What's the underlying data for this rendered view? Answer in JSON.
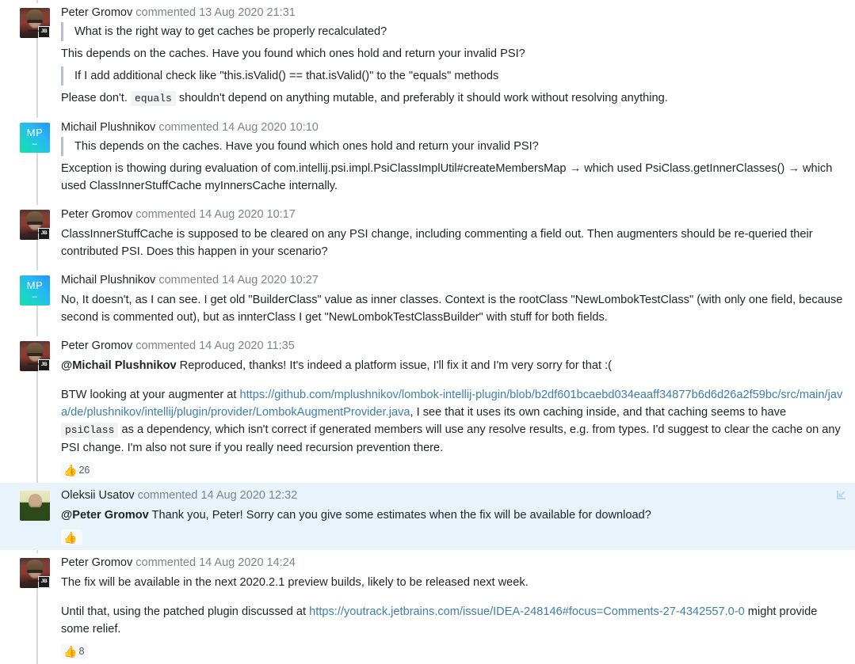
{
  "thread": {
    "comments": [
      {
        "id": "c1",
        "author": "Peter Gromov",
        "verb": "commented",
        "timestamp": "13 Aug 2020 21:31",
        "avatar_type": "photo-peter",
        "avatar_badge": "JB",
        "highlighted": false,
        "blocks": [
          {
            "type": "quote",
            "text": "What is the right way to get caches be properly recalculated?"
          },
          {
            "type": "p",
            "text": "This depends on the caches. Have you found which ones hold and return your invalid PSI?"
          },
          {
            "type": "quote",
            "text": "If I add additional check like \"this.isValid() == that.isValid()\" to the \"equals\" methods"
          },
          {
            "type": "p-rich",
            "parts": [
              {
                "t": "text",
                "v": "Please don't. "
              },
              {
                "t": "code",
                "v": "equals"
              },
              {
                "t": "text",
                "v": " shouldn't depend on anything mutable, and preferably it should work without resolving anything."
              }
            ]
          }
        ],
        "reactions": []
      },
      {
        "id": "c2",
        "author": "Michail Plushnikov",
        "verb": "commented",
        "timestamp": "14 Aug 2020 10:10",
        "avatar_type": "initials",
        "avatar_initials": "MP",
        "avatar_initials_second": "–",
        "highlighted": false,
        "blocks": [
          {
            "type": "quote",
            "text": "This depends on the caches. Have you found which ones hold and return your invalid PSI?"
          },
          {
            "type": "p",
            "text": "Exception is thowing during evaluation of com.intellij.psi.impl.PsiClassImplUtil#createMembersMap → which used PsiClass.getInnerClasses() → which used ClassInnerStuffCache myInnersCache internally."
          }
        ],
        "reactions": []
      },
      {
        "id": "c3",
        "author": "Peter Gromov",
        "verb": "commented",
        "timestamp": "14 Aug 2020 10:17",
        "avatar_type": "photo-peter",
        "avatar_badge": "JB",
        "highlighted": false,
        "blocks": [
          {
            "type": "p",
            "text": "ClassInnerStuffCache is supposed to be cleared on any PSI change, including commenting a field out. Then augmenters should be re-queried their contributed PSI. Does this happen in your scenario?"
          }
        ],
        "reactions": []
      },
      {
        "id": "c4",
        "author": "Michail Plushnikov",
        "verb": "commented",
        "timestamp": "14 Aug 2020 10:27",
        "avatar_type": "initials",
        "avatar_initials": "MP",
        "avatar_initials_second": "–",
        "highlighted": false,
        "blocks": [
          {
            "type": "p",
            "text": "No, It doesn't, as I can see. I get old \"BuilderClass\" value as inner classes. Context is the rootClass \"NewLombokTestClass\" (with only one field, because second is commented out), but as innterClass I get \"NewLombokTestClassBuilder\" with stuff for both fields."
          }
        ],
        "reactions": []
      },
      {
        "id": "c5",
        "author": "Peter Gromov",
        "verb": "commented",
        "timestamp": "14 Aug 2020 11:35",
        "avatar_type": "photo-peter",
        "avatar_badge": "JB",
        "highlighted": false,
        "blocks": [
          {
            "type": "p-rich",
            "parts": [
              {
                "t": "mention",
                "v": "@Michail Plushnikov"
              },
              {
                "t": "text",
                "v": " Reproduced, thanks! It's indeed a platform issue, I'll fix it and I'm very sorry for that :("
              }
            ]
          },
          {
            "type": "p-rich-spaced",
            "parts": [
              {
                "t": "text",
                "v": "BTW looking at your augmenter at "
              },
              {
                "t": "link",
                "v": "https://github.com/mplushnikov/lombok-intellij-plugin/blob/b2df601bcaebd034eaaff34877b6d6d26a2f59bc/src/main/java/de/plushnikov/intellij/plugin/provider/LombokAugmentProvider.java"
              },
              {
                "t": "text",
                "v": ", I see that it uses its own caching inside, and that caching seems to have "
              },
              {
                "t": "code",
                "v": "psiClass"
              },
              {
                "t": "text",
                "v": " as a dependency, which isn't correct if generated members will use any resolve results, e.g. from types. I'd suggest to clear the cache on any PSI change. I'm also not sure if you really need recursion prevention there."
              }
            ]
          }
        ],
        "reactions": [
          {
            "emoji": "👍",
            "name": "thumbs-up",
            "count": "26"
          }
        ]
      },
      {
        "id": "c6",
        "author": "Oleksii Usatov",
        "verb": "commented",
        "timestamp": "14 Aug 2020 12:32",
        "avatar_type": "photo-oleksii",
        "highlighted": true,
        "expand_icon": "collapse-arrow-icon",
        "blocks": [
          {
            "type": "p-rich",
            "parts": [
              {
                "t": "mention",
                "v": "@Peter Gromov"
              },
              {
                "t": "text",
                "v": " Thank you, Peter! Sorry can you give some estimates when the fix will be available for download?"
              }
            ]
          }
        ],
        "reactions": [
          {
            "emoji": "👍",
            "name": "thumbs-up",
            "count": ""
          }
        ]
      },
      {
        "id": "c7",
        "author": "Peter Gromov",
        "verb": "commented",
        "timestamp": "14 Aug 2020 14:24",
        "avatar_type": "photo-peter",
        "avatar_badge": "JB",
        "highlighted": false,
        "blocks": [
          {
            "type": "p",
            "text": "The fix will be available in the next 2020.2.1 preview builds, likely to be released next week."
          },
          {
            "type": "p-rich-spaced",
            "parts": [
              {
                "t": "text",
                "v": "Until that, using the patched plugin discussed at "
              },
              {
                "t": "link",
                "v": "https://youtrack.jetbrains.com/issue/IDEA-248146#focus=Comments-27-4342557.0-0"
              },
              {
                "t": "text",
                "v": " might provide some relief."
              }
            ]
          }
        ],
        "reactions": [
          {
            "emoji": "👍",
            "name": "thumbs-up",
            "count": "8"
          }
        ]
      }
    ]
  },
  "colors": {
    "link": "#3e7ead",
    "meta_muted": "#7c858c",
    "text": "#1f2326",
    "highlight_bg": "#e8f3fb",
    "rail": "#d6dadd",
    "quote_bar": "#b9c0c5",
    "code_bg": "#f1f3f4",
    "reaction_bg": "#f7f8f8"
  }
}
